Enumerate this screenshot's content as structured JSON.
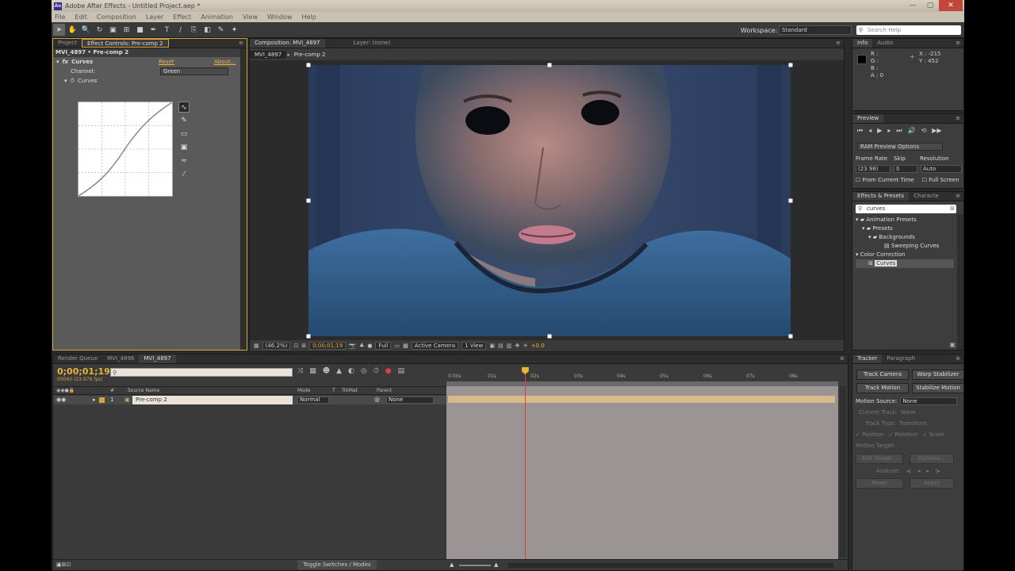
{
  "window": {
    "title": "Adobe After Effects - Untitled Project.aep *",
    "app_badge": "Ae",
    "controls": [
      "—",
      "▢",
      "✕"
    ]
  },
  "menu": [
    "File",
    "Edit",
    "Composition",
    "Layer",
    "Effect",
    "Animation",
    "View",
    "Window",
    "Help"
  ],
  "toolbar": {
    "tools": [
      "selection-tool",
      "hand-tool",
      "zoom-tool",
      "rotate-tool",
      "camera-tool",
      "pan-behind-tool",
      "rectangle-tool",
      "pen-tool",
      "type-tool",
      "brush-tool",
      "clone-tool",
      "eraser-tool",
      "roto-brush-tool",
      "puppet-tool"
    ],
    "workspace_label": "Workspace:",
    "workspace_value": "Standard",
    "search_placeholder": "Search Help"
  },
  "effect_controls": {
    "tabs": [
      "Project",
      "Effect Controls: Pre-comp 2"
    ],
    "header": "MVI_4897 • Pre-comp 2",
    "fx_name": "Curves",
    "reset": "Reset",
    "about": "About...",
    "channel_label": "Channel:",
    "channel_value": "Green",
    "curves_label": "Curves"
  },
  "composition": {
    "tabs": [
      "Composition: MVI_4897",
      "Layer: (none)"
    ],
    "subtabs": [
      "MVI_4897",
      "Pre-comp 2"
    ],
    "zoom": "(46.2%)",
    "timecode": "0;00;01;19",
    "resolution": "Full",
    "camera": "Active Camera",
    "view": "1 View",
    "exposure": "+0.0"
  },
  "info": {
    "tabs": [
      "Info",
      "Audio"
    ],
    "rgba": [
      "R :",
      "G :",
      "B :",
      "A : 0"
    ],
    "x": "X : -215",
    "y": "Y : 452"
  },
  "preview": {
    "tab": "Preview",
    "ram_preview": "RAM Preview Options",
    "frame_rate_label": "Frame Rate",
    "skip_label": "Skip",
    "resolution_label": "Resolution",
    "frame_rate_value": "(23.98)",
    "skip_value": "0",
    "resolution_value": "Auto",
    "from_current": "From Current Time",
    "full_screen": "Full Screen"
  },
  "effects_presets": {
    "tabs": [
      "Effects & Presets",
      "Characte"
    ],
    "search_value": "curves",
    "tree": [
      {
        "label": "Animation Presets",
        "level": 0
      },
      {
        "label": "Presets",
        "level": 1
      },
      {
        "label": "Backgrounds",
        "level": 2
      },
      {
        "label": "Sweeping Curves",
        "level": 3
      },
      {
        "label": "Color Correction",
        "level": 0
      },
      {
        "label": "Curves",
        "level": 1
      }
    ]
  },
  "timeline": {
    "tabs": [
      "Render Queue",
      "MVI_4896",
      "MVI_4897"
    ],
    "timecode": "0;00;01;19",
    "frame_info": "00043 (23.976 fps)",
    "columns": [
      "#",
      "Source Name",
      "Mode",
      "T",
      "TrkMat",
      "Parent"
    ],
    "layer": {
      "index": "1",
      "name": "Pre-comp 2",
      "mode": "Normal",
      "parent": "None"
    },
    "ruler": [
      "0:00s",
      "01s",
      "02s",
      "03s",
      "04s",
      "05s",
      "06s",
      "07s",
      "08s"
    ],
    "footer": "Toggle Switches / Modes",
    "playhead_pct": 20
  },
  "tracker": {
    "tabs": [
      "Tracker",
      "Paragraph"
    ],
    "buttons": [
      "Track Camera",
      "Warp Stabilizer",
      "Track Motion",
      "Stabilize Motion"
    ],
    "motion_source_label": "Motion Source:",
    "motion_source_value": "None",
    "current_track_label": "Current Track:",
    "current_track_value": "None",
    "track_type_label": "Track Type:",
    "track_type_value": "Transform",
    "checks": [
      "Position",
      "Rotation",
      "Scale"
    ],
    "motion_target": "Motion Target:",
    "edit_target": "Edit Target...",
    "options": "Options...",
    "analyze": "Analyze:",
    "reset": "Reset",
    "apply": "Apply"
  },
  "colors": {
    "accent": "#d8a33d",
    "timecode": "#e8b53c",
    "playhead": "#e23b3b"
  }
}
